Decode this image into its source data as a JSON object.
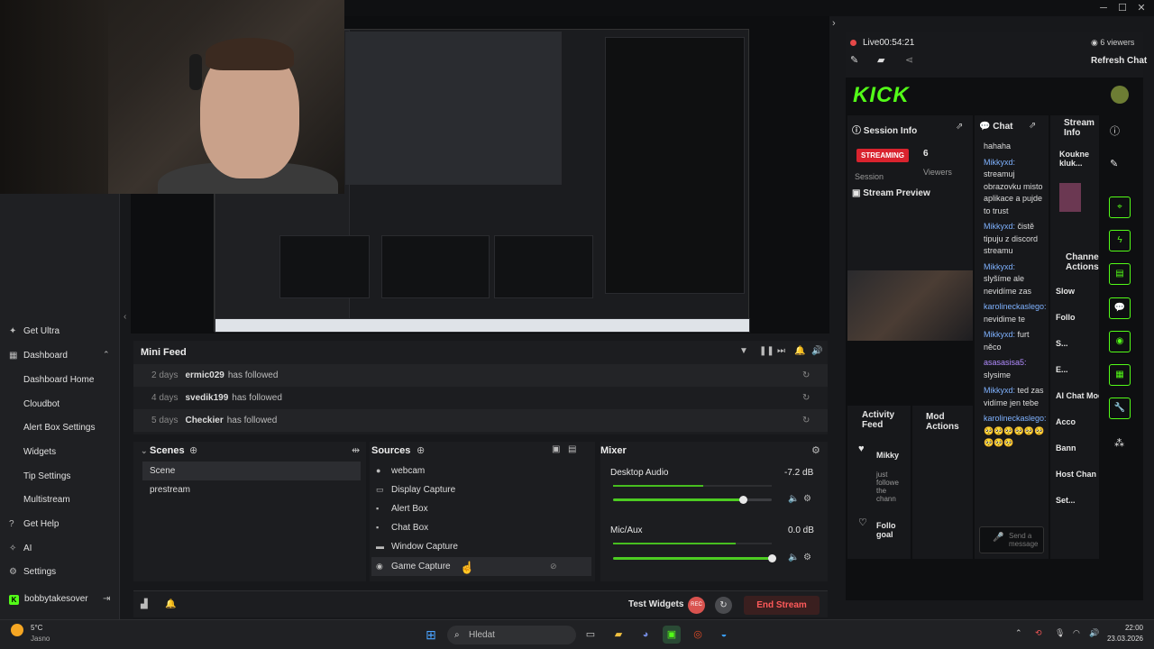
{
  "window": {
    "minimize": "─",
    "maximize": "☐",
    "close": "✕"
  },
  "sidebar": {
    "items": [
      {
        "label": "Get Ultra",
        "icon": "sparkle-icon",
        "glyph": "✦"
      },
      {
        "label": "Dashboard",
        "icon": "dashboard-icon",
        "glyph": "▦"
      },
      {
        "label": "Dashboard Home"
      },
      {
        "label": "Cloudbot"
      },
      {
        "label": "Alert Box Settings"
      },
      {
        "label": "Widgets"
      },
      {
        "label": "Tip Settings"
      },
      {
        "label": "Multistream"
      },
      {
        "label": "Get Help",
        "icon": "help-icon",
        "glyph": "?"
      },
      {
        "label": "AI",
        "icon": "ai-icon",
        "glyph": "✧"
      },
      {
        "label": "Settings",
        "icon": "gear-icon",
        "glyph": "⚙"
      }
    ],
    "user": "bobbytakesover"
  },
  "minifeed": {
    "title": "Mini Feed",
    "rows": [
      {
        "days": "2 days",
        "user": "ermic029",
        "action": "has followed"
      },
      {
        "days": "4 days",
        "user": "svedik199",
        "action": "has followed"
      },
      {
        "days": "5 days",
        "user": "Checkier",
        "action": "has followed"
      }
    ]
  },
  "scenes": {
    "title": "Scenes",
    "items": [
      "Scene",
      "prestream"
    ]
  },
  "sources": {
    "title": "Sources",
    "items": [
      "webcam",
      "Display Capture",
      "Alert Box",
      "Chat Box",
      "Window Capture",
      "Game Capture"
    ]
  },
  "mixer": {
    "title": "Mixer",
    "channels": [
      {
        "name": "Desktop Audio",
        "db": "-7.2 dB",
        "level": 0.82
      },
      {
        "name": "Mic/Aux",
        "db": "0.0 dB",
        "level": 1.0
      }
    ]
  },
  "bottombar": {
    "test_widgets": "Test Widgets",
    "rec": "REC",
    "end_stream": "End Stream"
  },
  "stream": {
    "status": "Live",
    "time": "00:54:21",
    "viewers": "6 viewers",
    "refresh": "Refresh Chat"
  },
  "kick": {
    "logo": "KICK",
    "session_info": "Session Info",
    "streaming_badge": "STREAMING",
    "session_count": "6",
    "session_label": "Session",
    "viewers_label": "Viewers",
    "stream_preview": "Stream Preview",
    "chat_title": "Chat",
    "stream_info": "Stream Info",
    "stream_info_text": "Koukne kluk...",
    "channel_actions": "Channel Actions",
    "actions": [
      "Slow",
      "Follo",
      "S...",
      "E...",
      "AI Chat Moderatio",
      "Acco",
      "Bann",
      "Host Chan",
      "Set..."
    ],
    "activity_feed": "Activity Feed",
    "activity_user": "Mikky",
    "activity_text": "just followe the chann",
    "follow_goal": "Follo goal",
    "mod_actions": "Mod Actions",
    "send_placeholder": "Send a message",
    "chat": [
      {
        "user": "",
        "text": "hahaha"
      },
      {
        "user": "Mikkyxd:",
        "text": "streamuj obrazovku misto aplikace a pujde to trust"
      },
      {
        "user": "Mikkyxd:",
        "text": "čistě tipuju z discord streamu"
      },
      {
        "user": "Mikkyxd:",
        "text": "slyšíme ale nevidíme zas"
      },
      {
        "user": "karolineckaslego:",
        "text": "nevidime te"
      },
      {
        "user": "Mikkyxd:",
        "text": "furt něco"
      },
      {
        "user": "asasasisa5:",
        "text": "slysime"
      },
      {
        "user": "Mikkyxd:",
        "text": "ted zas vidíme jen tebe"
      },
      {
        "user": "karolineckaslego:",
        "text": "🥺🥺🥺🥺🥺🥺🥺🥺🥺"
      }
    ]
  },
  "taskbar": {
    "temp": "5°C",
    "weather": "Jasno",
    "search": "Hledat",
    "time": "22:00",
    "date": "23.03.2026"
  }
}
